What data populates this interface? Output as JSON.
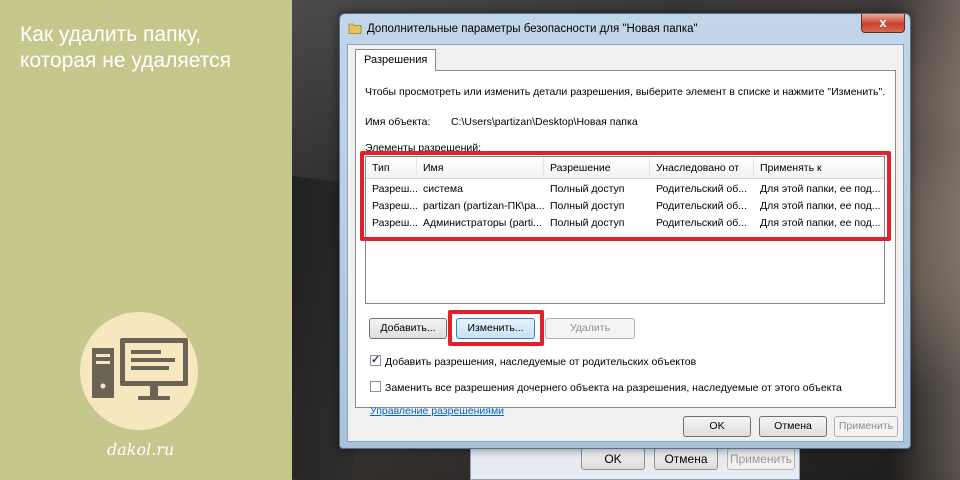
{
  "article": {
    "title_line1": "Как удалить папку,",
    "title_line2": "которая не удаляется",
    "site": "dakol.ru"
  },
  "back_window": {
    "ok_label": "OK",
    "cancel_label": "Отмена",
    "apply_label": "Применить"
  },
  "dialog": {
    "title": "Дополнительные параметры безопасности  для \"Новая папка\"",
    "close_glyph": "x",
    "tab_label": "Разрешения",
    "instruction": "Чтобы просмотреть или изменить детали разрешения, выберите элемент в списке и нажмите \"Изменить\".",
    "object_label": "Имя объекта:",
    "object_value": "C:\\Users\\partizan\\Desktop\\Новая папка",
    "list_label": "Элементы разрешений:",
    "columns": [
      "Тип",
      "Имя",
      "Разрешение",
      "Унаследовано от",
      "Применять к"
    ],
    "rows": [
      [
        "Разреш...",
        "система",
        "Полный доступ",
        "Родительский об...",
        "Для этой папки, ее под..."
      ],
      [
        "Разреш...",
        "partizan (partizan-ПК\\pa...",
        "Полный доступ",
        "Родительский об...",
        "Для этой папки, ее под..."
      ],
      [
        "Разреш...",
        "Администраторы (parti...",
        "Полный доступ",
        "Родительский об...",
        "Для этой папки, ее под..."
      ]
    ],
    "add_label": "Добавить...",
    "edit_label": "Изменить...",
    "remove_label": "Удалить",
    "inherit_checkbox": "Добавить разрешения, наследуемые от родительских объектов",
    "inherit_checked": true,
    "replace_checkbox": "Заменить все разрешения дочернего объекта на разрешения, наследуемые от этого объекта",
    "replace_checked": false,
    "manage_link": "Управление разрешениями",
    "ok_label": "OK",
    "cancel_label": "Отмена",
    "apply_label": "Применить"
  },
  "colors": {
    "highlight": "#e0202a",
    "left_panel": "#c6c78d",
    "link": "#0066cc"
  },
  "icons": [
    "computer-monitor-icon",
    "folder-icon"
  ]
}
